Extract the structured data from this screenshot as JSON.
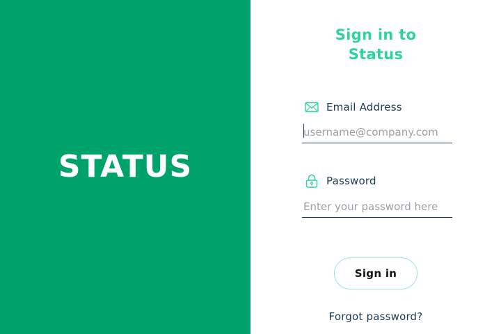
{
  "brand": {
    "logo_text": "STATUS",
    "panel_color": "#00a26b"
  },
  "form": {
    "title_line1": "Sign in to",
    "title_line2": "Status",
    "email": {
      "icon": "envelope-icon",
      "label": "Email Address",
      "value": "",
      "placeholder": "username@company.com"
    },
    "password": {
      "icon": "lock-icon",
      "label": "Password",
      "value": "",
      "placeholder": "Enter your password here"
    },
    "submit_label": "Sign in",
    "forgot_label": "Forgot password?",
    "accent_color": "#2ed3a0",
    "text_color": "#1b3a57"
  }
}
